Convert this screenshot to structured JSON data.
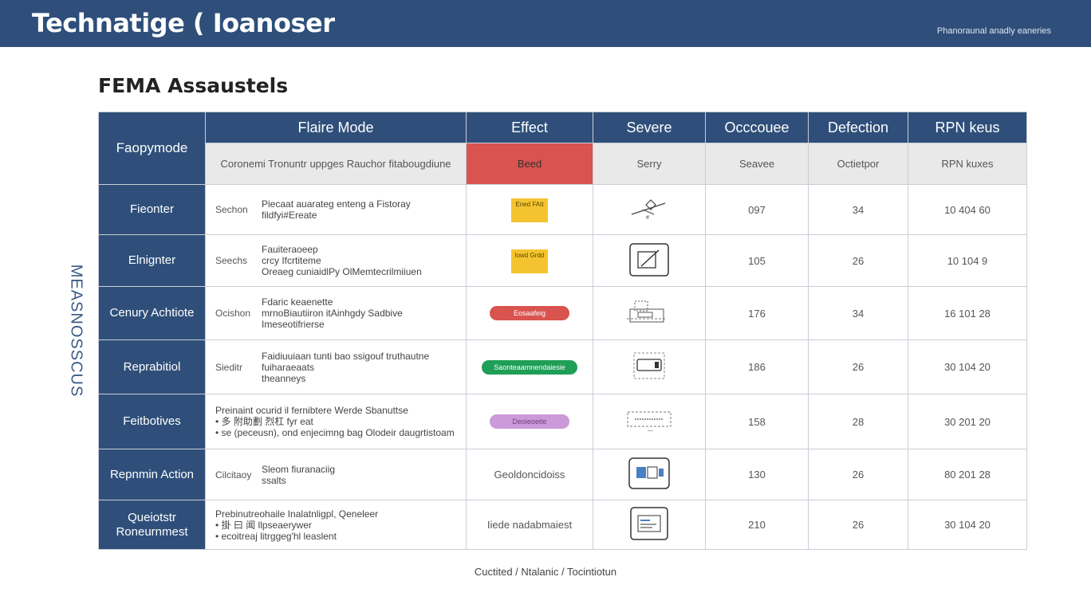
{
  "header": {
    "title": "Technatige ( Ioanoser",
    "right_text": "Phanoraunal anadly eaneries"
  },
  "page_title": "FEMA Assaustels",
  "side_label": "MEASNOSSCUS",
  "table": {
    "corner": "Faopymode",
    "columns": [
      "Flaire Mode",
      "Effect",
      "Severe",
      "Occcouee",
      "Defection",
      "RPN keus"
    ],
    "subheader": [
      "Coronemi Tronuntr uppges Rauchor fitabougdiune",
      "Beed",
      "Serry",
      "Seavee",
      "Octietpor",
      "RPN kuxes"
    ],
    "rows": [
      {
        "head": "Fieonter",
        "lead": "Sechon",
        "lines": [
          "Piecaat auarateg enteng a Fistoray",
          "fildfyi#Ereate"
        ],
        "effect": {
          "kind": "sticker",
          "text": "Ened FAtt"
        },
        "icon": "pen-icon",
        "severity": "097",
        "occurrence": "34",
        "rpn": "10  404  60"
      },
      {
        "head": "Elnignter",
        "lead": "Seechs",
        "lines": [
          "Fauiteraoeep",
          "crcy Ifcrtiteme",
          "Oreaeg cuniaidlPy OlMemtecrilmiiuen"
        ],
        "effect": {
          "kind": "sticker",
          "text": "lowd Grdd"
        },
        "icon": "edit-box-icon",
        "severity": "105",
        "occurrence": "26",
        "rpn": "10  104  9"
      },
      {
        "head": "Cenury Achtiote",
        "lead": "Ocishon",
        "lines": [
          "Fdaric keaenette",
          "mrnoBiautiiron itAinhgdy Sadbive",
          "Imeseotifrierse"
        ],
        "effect": {
          "kind": "pill-red",
          "text": "Eosaafeig"
        },
        "icon": "printer-icon",
        "severity": "176",
        "occurrence": "34",
        "rpn": "16  101  28"
      },
      {
        "head": "Reprabitiol",
        "lead": "Sieditr",
        "lines": [
          "Faidiuuiaan tunti bao ssigouf truthautne",
          "fuiharaeaats",
          "theanneys"
        ],
        "effect": {
          "kind": "pill-green",
          "text": "Saonteaamnendaiesie"
        },
        "icon": "card-icon",
        "severity": "186",
        "occurrence": "26",
        "rpn": "30  104  20"
      },
      {
        "head": "Feitbotives",
        "lead": "",
        "lines": [
          "Preinaint ocurid il fernibtere Werde Sbanuttse",
          "• 多 附助劃 烈杠 fyr eat",
          "• se (peceusn), ond enjecimng bag Olodeir daugrtistoam"
        ],
        "effect": {
          "kind": "pill-purple",
          "text": "Deoieoeite"
        },
        "icon": "dashed-box-icon",
        "severity": "158",
        "occurrence": "28",
        "rpn": "30  201  20"
      },
      {
        "head": "Repnmin Action",
        "lead": "Cilcitaoy",
        "lines": [
          "Sleom fiuranaciig",
          "ssalts"
        ],
        "effect": {
          "kind": "text",
          "text": "Geoldoncidoiss"
        },
        "icon": "monitor-icon",
        "severity": "130",
        "occurrence": "26",
        "rpn": "80  201  28"
      },
      {
        "head": "Queiotstr Roneurnmest",
        "lead": "",
        "lines": [
          "Prebinutreohaile Inalatnligpl, Qeneleer",
          "• 掛 曰 闻 llpseaerywer",
          "• ecoitreaj litrggeg'hl leaslent"
        ],
        "effect": {
          "kind": "text",
          "text": "Iiede nadabmaiest"
        },
        "icon": "chart-box-icon",
        "severity": "210",
        "occurrence": "26",
        "rpn": "30  104  20"
      }
    ]
  },
  "footer": "Cuctited / Ntalanic / Tocintiotun"
}
